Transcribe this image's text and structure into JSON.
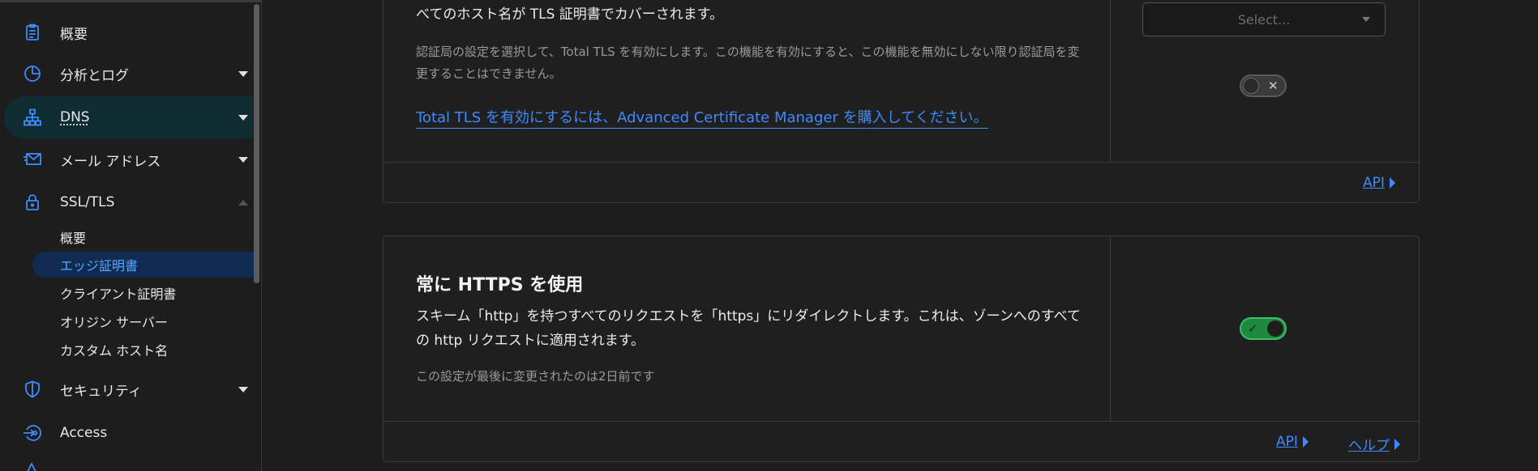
{
  "sidebar": {
    "items": [
      {
        "label": "概要",
        "icon": "clipboard-icon"
      },
      {
        "label": "分析とログ",
        "icon": "pie-chart-icon"
      },
      {
        "label": "DNS",
        "icon": "network-icon"
      },
      {
        "label": "メール アドレス",
        "icon": "envelope-icon"
      },
      {
        "label": "SSL/TLS",
        "icon": "lock-icon"
      },
      {
        "label": "セキュリティ",
        "icon": "shield-icon"
      },
      {
        "label": "Access",
        "icon": "access-icon"
      }
    ],
    "ssl_sub_items": [
      {
        "label": "概要"
      },
      {
        "label": "エッジ証明書"
      },
      {
        "label": "クライアント証明書"
      },
      {
        "label": "オリジン サーバー"
      },
      {
        "label": "カスタム ホスト名"
      }
    ]
  },
  "total_tls": {
    "description_tail": "べてのホスト名が TLS 証明書でカバーされます。",
    "note": "認証局の設定を選択して、Total TLS を有効にします。この機能を有効にすると、この機能を無効にしない限り認証局を変更することはできません。",
    "purchase_link": "Total TLS を有効にするには、Advanced Certificate Manager を購入してください。",
    "select_placeholder": "Select...",
    "toggle_state": "off",
    "api_label": "API"
  },
  "always_https": {
    "title": "常に HTTPS を使用",
    "description": "スキーム「http」を持つすべてのリクエストを「https」にリダイレクトします。これは、ゾーンへのすべての http リクエストに適用されます。",
    "last_changed": "この設定が最後に変更されたのは2日前です",
    "toggle_state": "on",
    "api_label": "API",
    "help_label": "ヘルプ"
  },
  "colors": {
    "accent": "#3d8bff",
    "toggle_on": "#1e8a3e",
    "active_nav_bg": "#0f2c33",
    "selected_sub_bg": "#0f2b52"
  }
}
